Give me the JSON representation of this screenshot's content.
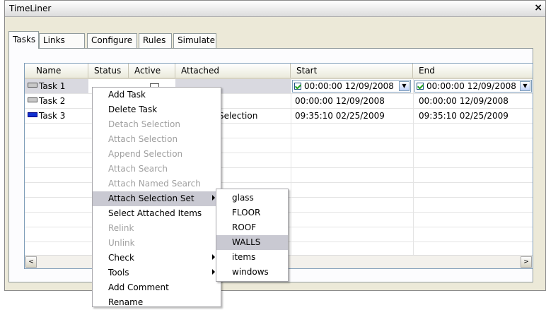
{
  "window": {
    "title": "TimeLiner",
    "close_glyph": "×"
  },
  "tabs": [
    {
      "label": "Tasks"
    },
    {
      "label": "Links"
    },
    {
      "label": "Configure"
    },
    {
      "label": "Rules"
    },
    {
      "label": "Simulate"
    }
  ],
  "table": {
    "columns": [
      "Name",
      "Status",
      "Active",
      "Attached",
      "Start",
      "End"
    ],
    "rows": [
      {
        "name": "Task 1",
        "attached": "",
        "start": "00:00:00 12/09/2008",
        "end": "00:00:00 12/09/2008",
        "icon": "task-bar-gray"
      },
      {
        "name": "Task 2",
        "attached": "",
        "start": "00:00:00 12/09/2008",
        "end": "00:00:00 12/09/2008",
        "icon": "task-bar-gray"
      },
      {
        "name": "Task 3",
        "attached": "Selection",
        "start": "09:35:10 02/25/2009",
        "end": "09:35:10 02/25/2009",
        "icon": "task-bar-blue"
      }
    ],
    "scroll_left": "<",
    "scroll_right": ">"
  },
  "context_menu": {
    "items": [
      {
        "label": "Add Task",
        "enabled": true
      },
      {
        "label": "Delete Task",
        "enabled": true
      },
      {
        "label": "Detach Selection",
        "enabled": false
      },
      {
        "label": "Attach Selection",
        "enabled": false
      },
      {
        "label": "Append Selection",
        "enabled": false
      },
      {
        "label": "Attach Search",
        "enabled": false
      },
      {
        "label": "Attach Named Search",
        "enabled": false
      },
      {
        "label": "Attach Selection Set",
        "enabled": true,
        "submenu": true,
        "highlighted": true
      },
      {
        "label": "Select Attached Items",
        "enabled": true
      },
      {
        "label": "Relink",
        "enabled": false
      },
      {
        "label": "Unlink",
        "enabled": false
      },
      {
        "label": "Check",
        "enabled": true,
        "submenu": true
      },
      {
        "label": "Tools",
        "enabled": true,
        "submenu": true
      },
      {
        "label": "Add Comment",
        "enabled": true
      },
      {
        "label": "Rename",
        "enabled": true
      }
    ]
  },
  "submenu": {
    "items": [
      {
        "label": "glass"
      },
      {
        "label": "FLOOR"
      },
      {
        "label": "ROOF"
      },
      {
        "label": "WALLS",
        "highlighted": true
      },
      {
        "label": "items"
      },
      {
        "label": "windows"
      }
    ]
  },
  "colors": {
    "highlight": "#c9c9d2",
    "window_bg": "#ece9d8",
    "disabled_text": "#a0a0a0"
  }
}
